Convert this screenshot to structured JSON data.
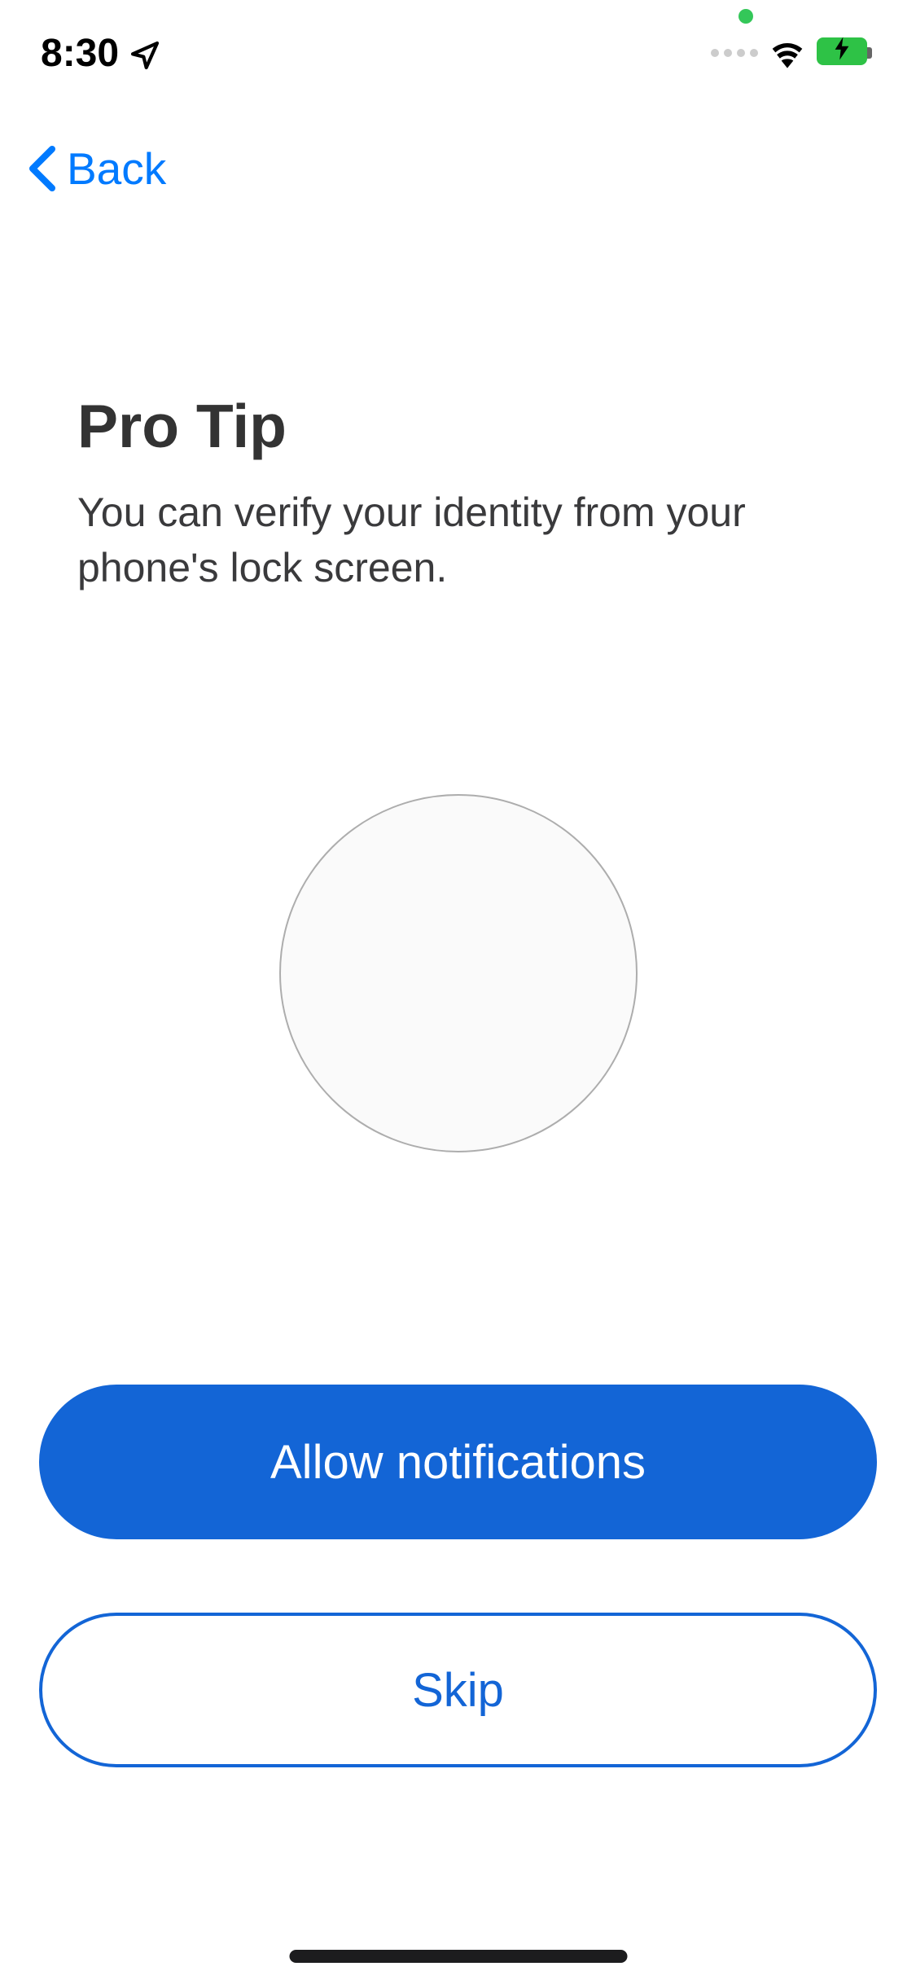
{
  "status_bar": {
    "time": "8:30"
  },
  "navigation": {
    "back_label": "Back"
  },
  "content": {
    "title": "Pro Tip",
    "description": "You can verify your identity from your phone's lock screen."
  },
  "buttons": {
    "primary_label": "Allow notifications",
    "secondary_label": "Skip"
  }
}
